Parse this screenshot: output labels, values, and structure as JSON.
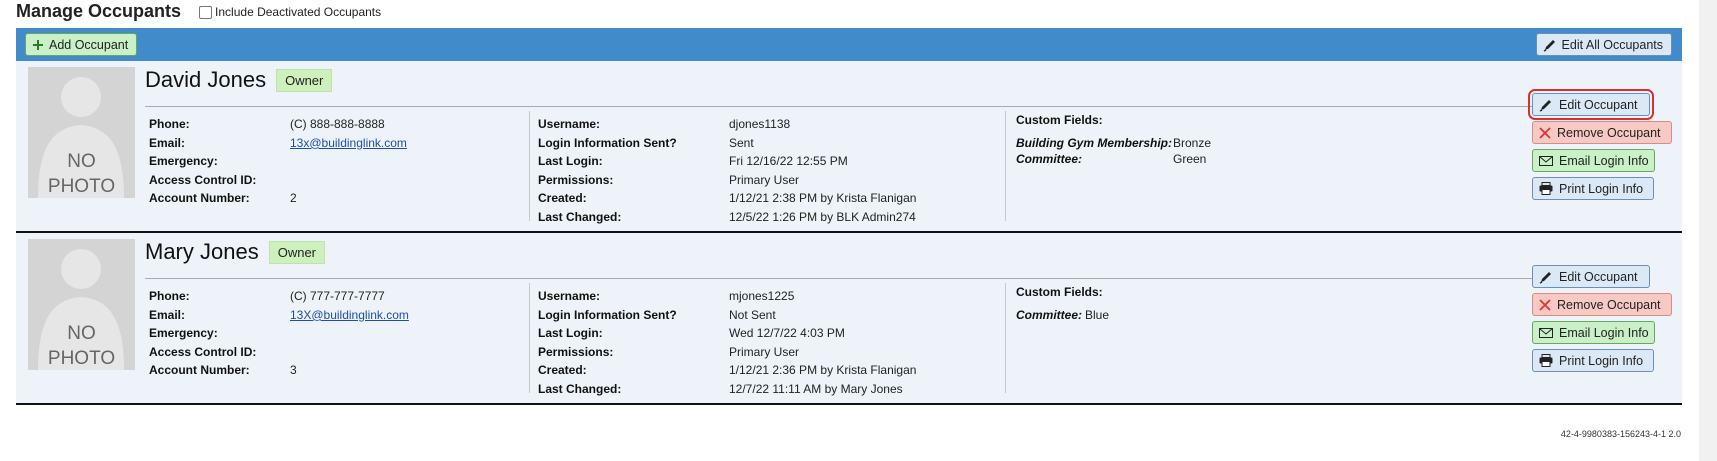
{
  "page": {
    "title": "Manage Occupants",
    "include_deactivated_label": "Include Deactivated Occupants",
    "add_button": "Add Occupant",
    "edit_all_button": "Edit All Occupants",
    "footer_code": "42-4-9980383-156243-4-1 2.0"
  },
  "labels": {
    "phone": "Phone:",
    "email": "Email:",
    "emergency": "Emergency:",
    "access_control": "Access Control ID:",
    "account_number": "Account Number:",
    "username": "Username:",
    "login_sent": "Login Information Sent?",
    "last_login": "Last Login:",
    "permissions": "Permissions:",
    "created": "Created:",
    "last_changed": "Last Changed:",
    "custom_fields": "Custom Fields:",
    "no": "NO",
    "photo": "PHOTO"
  },
  "actions": {
    "edit": "Edit Occupant",
    "remove": "Remove Occupant",
    "email": "Email Login Info",
    "print": "Print Login Info"
  },
  "occupants": [
    {
      "name": "David Jones",
      "role": "Owner",
      "phone": "(C) 888-888-8888",
      "email": "13x@buildinglink.com",
      "emergency": "",
      "access_control_id": "",
      "account_number": "2",
      "username": "djones1138",
      "login_sent": "Sent",
      "last_login": "Fri 12/16/22 12:55 PM",
      "permissions": "Primary User",
      "created": "1/12/21 2:38 PM by Krista Flanigan",
      "last_changed": "12/5/22 1:26 PM by BLK Admin274",
      "custom_fields": [
        {
          "label": "Building Gym Membership:",
          "value": "Bronze"
        },
        {
          "label": "Committee:",
          "value": "Green"
        }
      ]
    },
    {
      "name": "Mary Jones",
      "role": "Owner",
      "phone": "(C) 777-777-7777",
      "email": "13X@buildinglink.com",
      "emergency": "",
      "access_control_id": "",
      "account_number": "3",
      "username": "mjones1225",
      "login_sent": "Not Sent",
      "last_login": "Wed 12/7/22 4:03 PM",
      "permissions": "Primary User",
      "created": "1/12/21 2:36 PM by Krista Flanigan",
      "last_changed": "12/7/22 11:11 AM by Mary Jones",
      "custom_fields": [
        {
          "label": "Committee:",
          "value": "Blue"
        }
      ]
    }
  ]
}
